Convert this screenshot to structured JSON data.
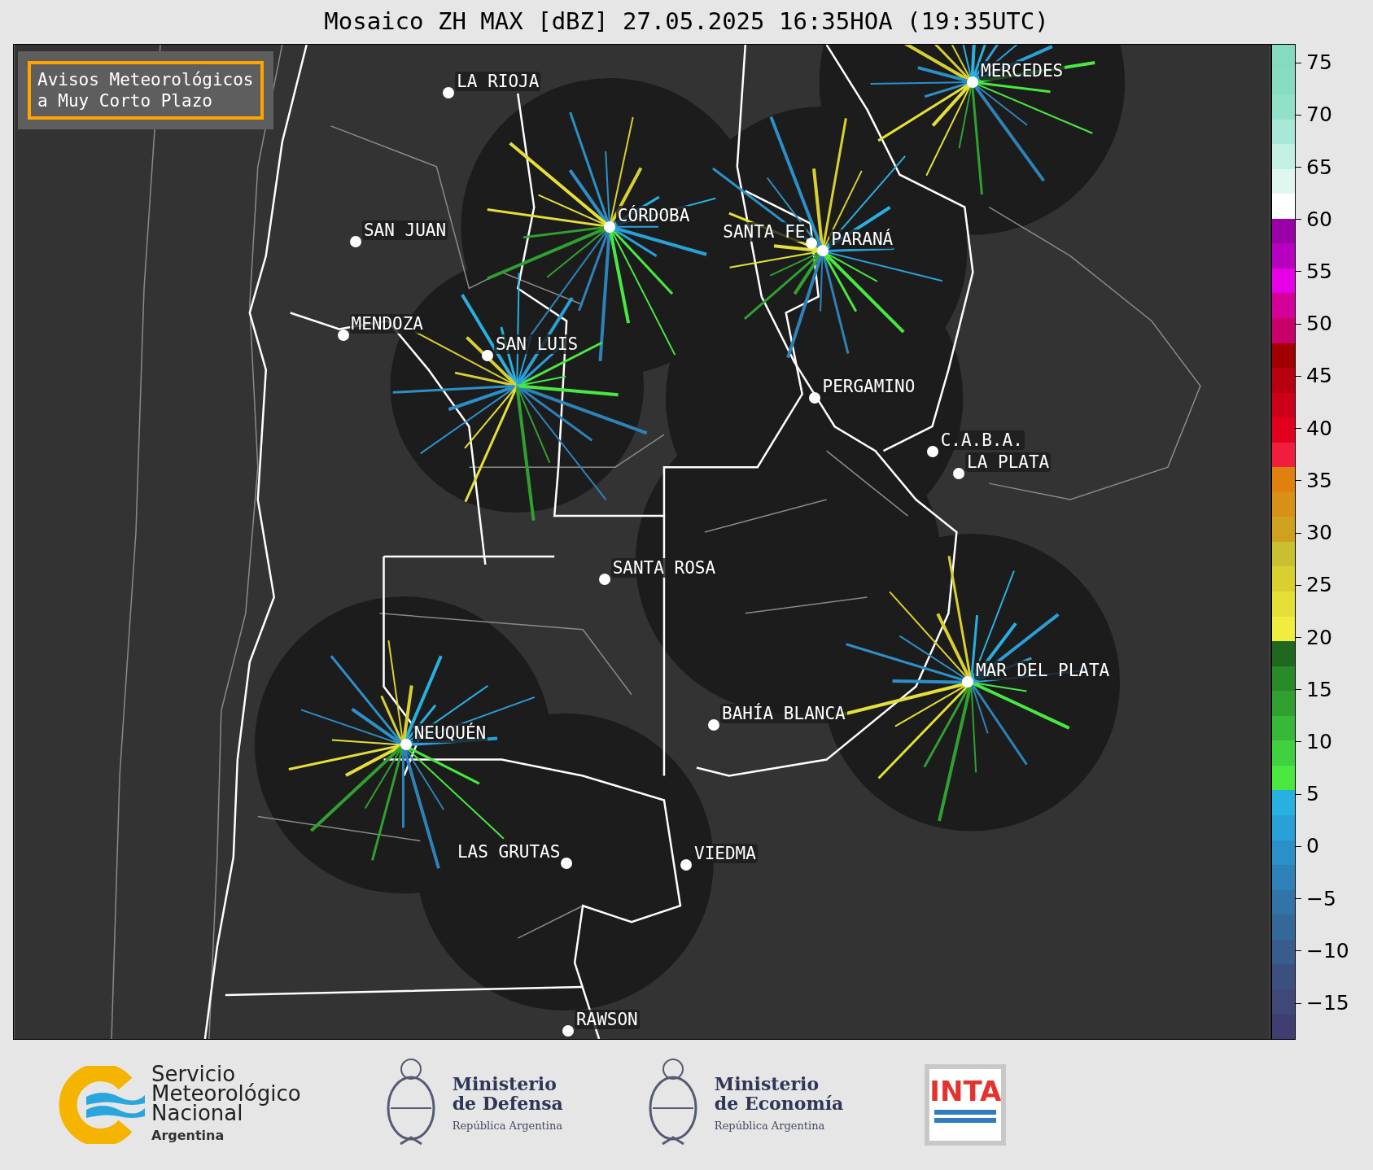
{
  "title": "Mosaico ZH MAX [dBZ] 27.05.2025 16:35HOA (19:35UTC)",
  "notice": {
    "lines": [
      "Avisos Meteorológicos",
      "a Muy Corto Plazo"
    ]
  },
  "cities": [
    {
      "name": "LA RIOJA"
    },
    {
      "name": "MERCEDES"
    },
    {
      "name": "CÓRDOBA"
    },
    {
      "name": "SAN JUAN"
    },
    {
      "name": "SANTA FE"
    },
    {
      "name": "PARANÁ"
    },
    {
      "name": "MENDOZA"
    },
    {
      "name": "SAN LUIS"
    },
    {
      "name": "PERGAMINO"
    },
    {
      "name": "C.A.B.A."
    },
    {
      "name": "LA PLATA"
    },
    {
      "name": "SANTA ROSA"
    },
    {
      "name": "MAR DEL PLATA"
    },
    {
      "name": "BAHÍA BLANCA"
    },
    {
      "name": "NEUQUÉN"
    },
    {
      "name": "LAS GRUTAS"
    },
    {
      "name": "VIEDMA"
    },
    {
      "name": "RAWSON"
    }
  ],
  "colorbar": {
    "ticks": [
      "75",
      "70",
      "65",
      "60",
      "55",
      "50",
      "45",
      "40",
      "35",
      "30",
      "25",
      "20",
      "15",
      "10",
      "5",
      "0",
      "−5",
      "−10",
      "−15"
    ]
  },
  "logos": [
    {
      "kind": "smn",
      "lines": [
        "Servicio",
        "Meteorológico",
        "Nacional"
      ],
      "subtitle": "Argentina"
    },
    {
      "kind": "ministry",
      "lines": [
        "Ministerio",
        "de Defensa"
      ],
      "subtitle": "República Argentina"
    },
    {
      "kind": "ministry",
      "lines": [
        "Ministerio",
        "de Economía"
      ],
      "subtitle": "República Argentina"
    },
    {
      "kind": "inta",
      "lines": [
        "INTA"
      ]
    }
  ]
}
